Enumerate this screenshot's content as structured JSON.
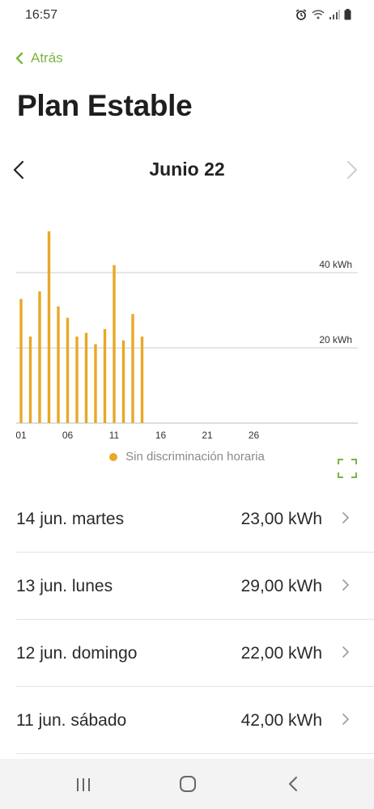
{
  "status_bar": {
    "time": "16:57",
    "icons": [
      "alarm-icon",
      "wifi-icon",
      "signal-icon",
      "battery-icon"
    ]
  },
  "header": {
    "back_label": "Atrás",
    "title": "Plan Estable"
  },
  "period": {
    "label": "Junio 22"
  },
  "colors": {
    "accent_green": "#7cb342",
    "bar_orange": "#e8a826",
    "gridline": "#cccccc"
  },
  "chart_data": {
    "type": "bar",
    "days": 30,
    "x_tick_labels": [
      "01",
      "06",
      "11",
      "16",
      "21",
      "26"
    ],
    "x_tick_days": [
      1,
      6,
      11,
      16,
      21,
      26
    ],
    "bar_days": [
      1,
      2,
      3,
      4,
      5,
      6,
      7,
      8,
      9,
      10,
      11,
      12,
      13,
      14
    ],
    "values": [
      33,
      23,
      35,
      51,
      31,
      28,
      23,
      24,
      21,
      25,
      42,
      22,
      29,
      23
    ],
    "unit": "kWh",
    "y_gridlines": [
      {
        "value": 20,
        "label": "20 kWh"
      },
      {
        "value": 40,
        "label": "40 kWh"
      }
    ],
    "ylim": [
      0,
      55
    ],
    "legend": [
      {
        "name": "Sin discriminación horaria",
        "color": "#e8a826"
      }
    ]
  },
  "daily_list": [
    {
      "date": "14 jun. martes",
      "value": "23,00 kWh"
    },
    {
      "date": "13 jun. lunes",
      "value": "29,00 kWh"
    },
    {
      "date": "12 jun. domingo",
      "value": "22,00 kWh"
    },
    {
      "date": "11 jun. sábado",
      "value": "42,00 kWh"
    }
  ]
}
